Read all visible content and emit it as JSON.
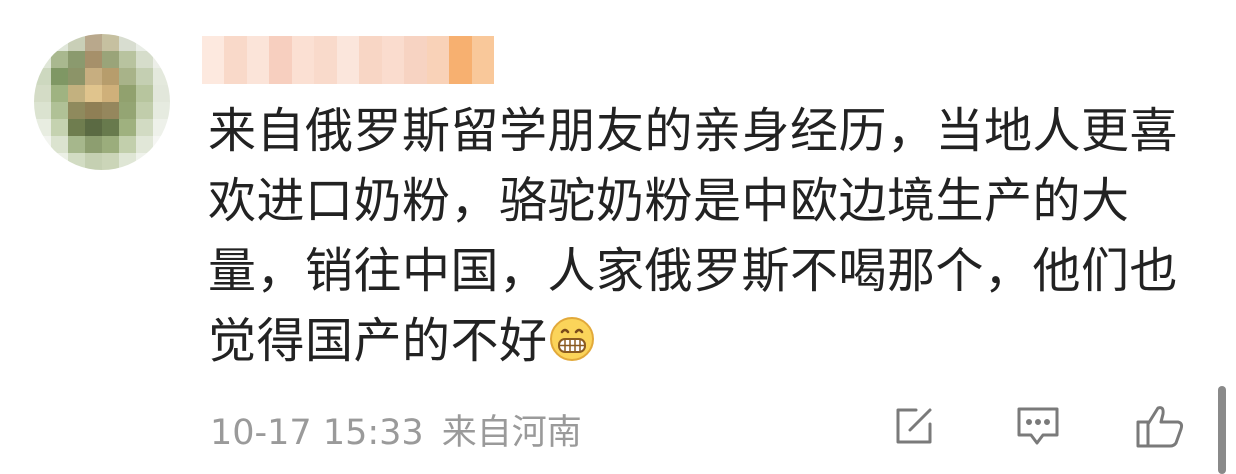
{
  "comment": {
    "avatar": "avatar (pixelated)",
    "username": "",
    "text": "来自俄罗斯留学朋友的亲身经历，当地人更喜欢进口奶粉，骆驼奶粉是中欧边境生产的大量，销往中国，人家俄罗斯不喝那个，他们也觉得国产的不好",
    "emoji": "grinning-face",
    "time": "10-17 15:33",
    "location": "来自河南"
  },
  "actions": {
    "repost_icon": "edit-share-icon",
    "reply_icon": "comment-icon",
    "like_icon": "thumbs-up-icon"
  },
  "colors": {
    "text": "#222222",
    "meta": "#9a9a9a",
    "icon": "#7a7a7a"
  }
}
